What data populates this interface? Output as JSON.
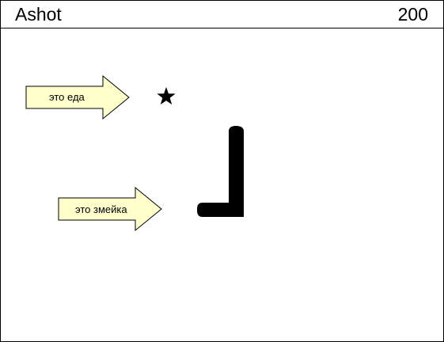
{
  "header": {
    "player_name": "Ashot",
    "score": "200"
  },
  "board": {
    "food_label": "это еда",
    "snake_label": "это змейка",
    "callout_fill": "#ffffcc",
    "snake_color": "#000000",
    "food_color": "#000000",
    "food_icon": "star-icon"
  }
}
